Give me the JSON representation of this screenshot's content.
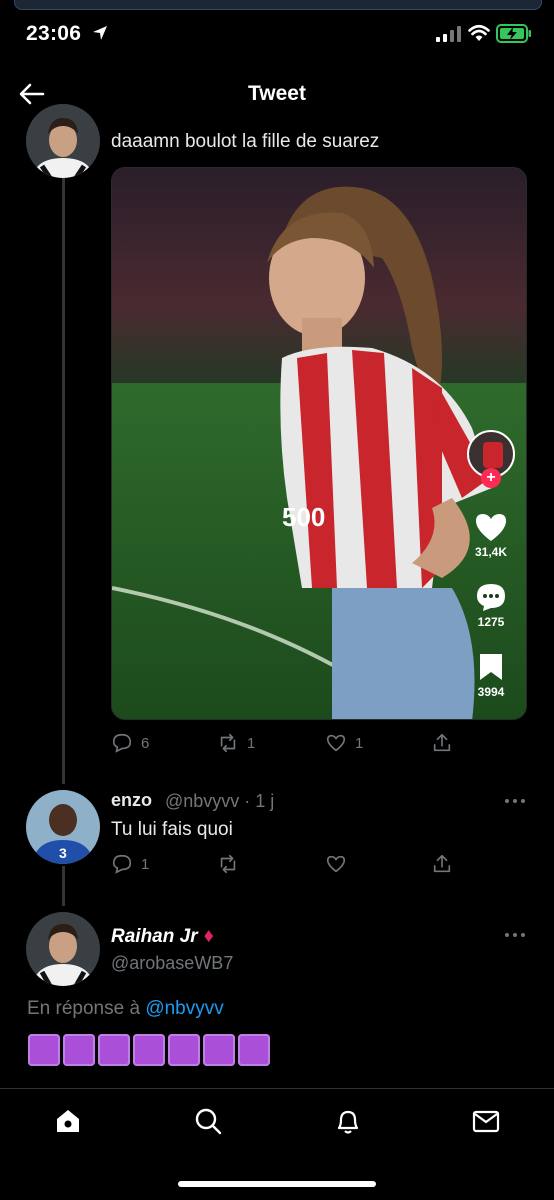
{
  "status_bar": {
    "time": "23:06"
  },
  "header": {
    "title": "Tweet"
  },
  "tweet": {
    "text": "daaamn boulot la fille de suarez",
    "video_overlay": {
      "likes": "31,4K",
      "comments": "1275",
      "saves": "3994",
      "jersey_text": "500"
    },
    "actions": {
      "replies": "6",
      "retweets": "1",
      "likes": "1"
    }
  },
  "reply": {
    "name": "enzo",
    "handle": "@nbvyvv · 1 j",
    "text": "Tu lui fais quoi",
    "actions": {
      "replies": "1"
    }
  },
  "author": {
    "name": "Raihan Jr",
    "badge": "♦",
    "handle": "@arobaseWB7",
    "reply_prefix": "En réponse à ",
    "reply_mention": "@nbvyvv",
    "emoji_count": 7
  },
  "colors": {
    "accent": "#1d9bf0",
    "muted": "#71767b",
    "emoji": "#a94fd8",
    "badge": "#e0245e"
  }
}
